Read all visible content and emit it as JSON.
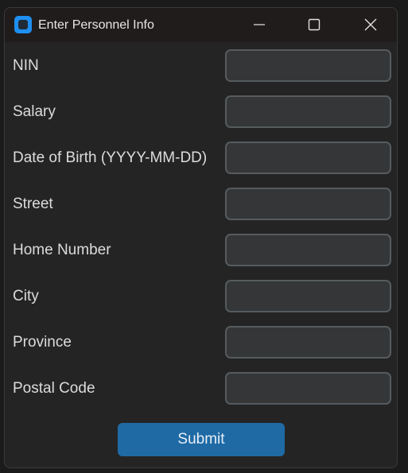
{
  "window": {
    "title": "Enter Personnel Info",
    "icons": {
      "app": "app-icon",
      "minimize": "minimize-icon",
      "maximize": "maximize-icon",
      "close": "close-icon"
    }
  },
  "form": {
    "fields": [
      {
        "label": "NIN",
        "value": ""
      },
      {
        "label": "Salary",
        "value": ""
      },
      {
        "label": "Date of Birth (YYYY-MM-DD)",
        "value": ""
      },
      {
        "label": "Street",
        "value": ""
      },
      {
        "label": "Home Number",
        "value": ""
      },
      {
        "label": "City",
        "value": ""
      },
      {
        "label": "Province",
        "value": ""
      },
      {
        "label": "Postal Code",
        "value": ""
      }
    ],
    "submit_label": "Submit"
  },
  "colors": {
    "background": "#242424",
    "field_bg": "#343638",
    "field_border": "#565b5e",
    "accent": "#1f6aa5"
  }
}
